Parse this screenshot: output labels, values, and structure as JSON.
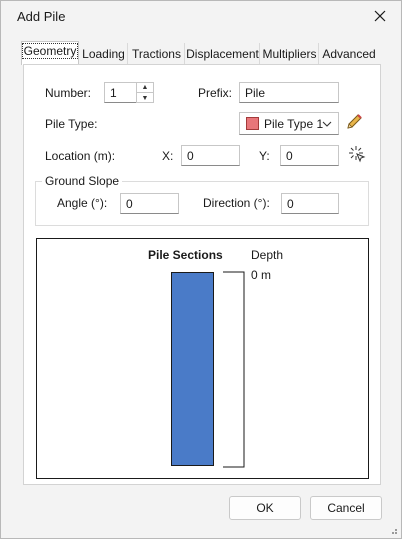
{
  "window": {
    "title": "Add Pile",
    "close_label": "✕"
  },
  "tabs": [
    {
      "label": "Geometry",
      "active": true
    },
    {
      "label": "Loading"
    },
    {
      "label": "Tractions"
    },
    {
      "label": "Displacement"
    },
    {
      "label": "Multipliers"
    },
    {
      "label": "Advanced"
    }
  ],
  "form": {
    "number_label": "Number:",
    "number_value": "1",
    "prefix_label": "Prefix:",
    "prefix_value": "Pile",
    "pile_type_label": "Pile Type:",
    "pile_type_value": "Pile Type 1",
    "pile_type_color": "#e8767a",
    "location_label": "Location (m):",
    "x_label": "X:",
    "x_value": "0",
    "y_label": "Y:",
    "y_value": "0"
  },
  "ground_slope": {
    "title": "Ground Slope",
    "angle_label": "Angle (°):",
    "angle_value": "0",
    "direction_label": "Direction (°):",
    "direction_value": "0"
  },
  "preview": {
    "sections_label": "Pile Sections",
    "depth_label": "Depth",
    "depth_value": "0 m",
    "pile_color": "#4a7bc8"
  },
  "buttons": {
    "ok": "OK",
    "cancel": "Cancel"
  }
}
